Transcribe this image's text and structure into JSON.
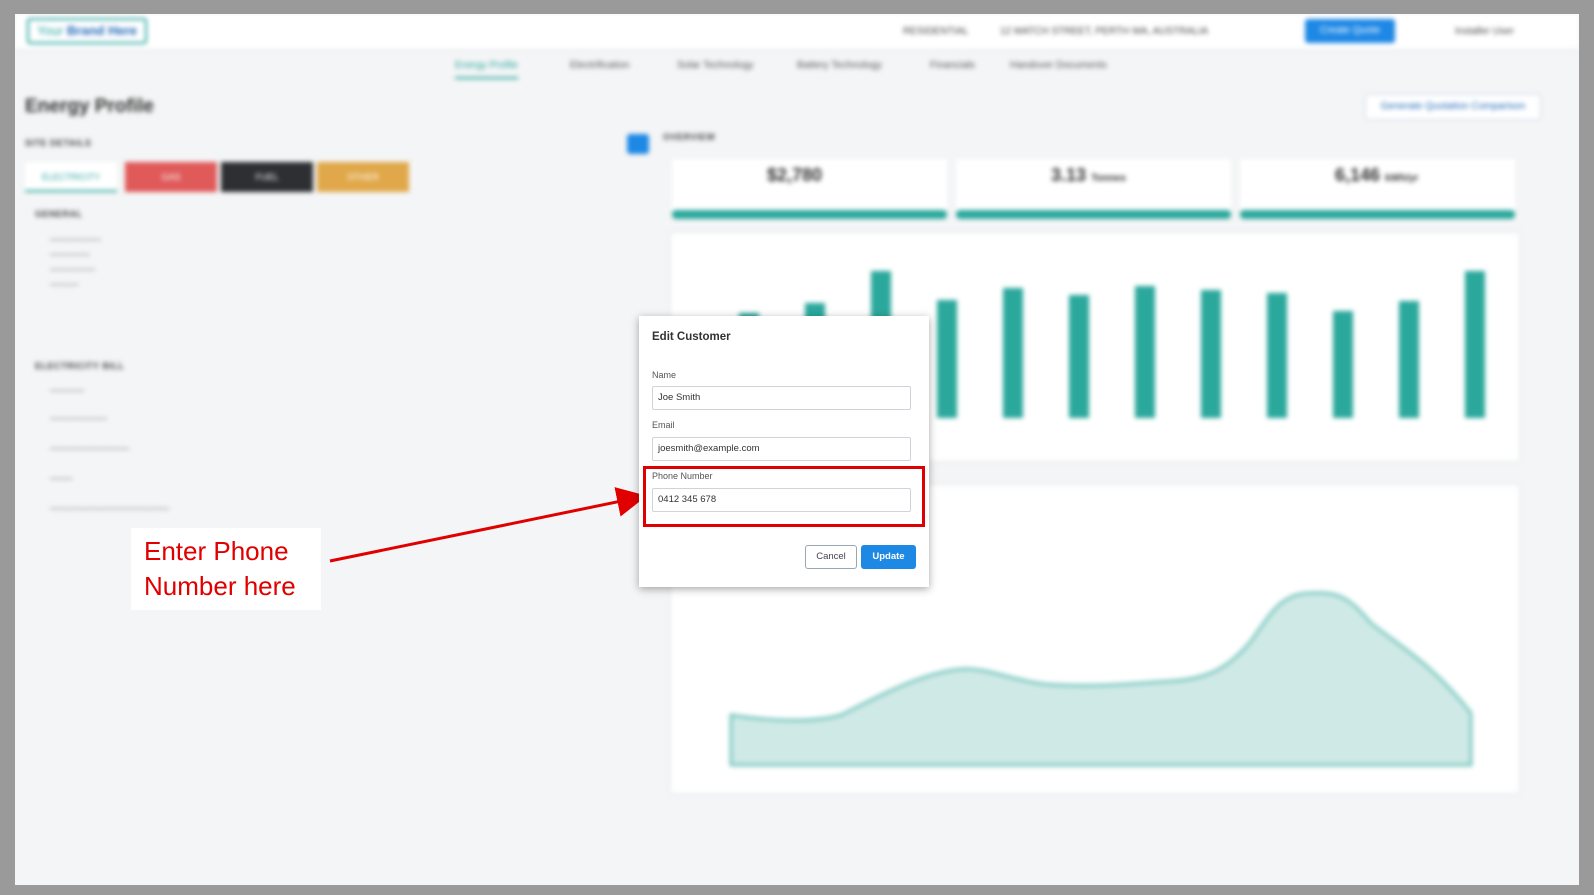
{
  "background_app": {
    "brand": {
      "prefix": "Your",
      "name": "Brand Here"
    },
    "topbar": {
      "type": "RESIDENTIAL",
      "address": "12 MATCH STREET, PERTH WA, AUSTRALIA",
      "create_label": "Create Quote",
      "user_label": "Installer User"
    },
    "tabs": [
      "Energy Profile",
      "Electrification",
      "Solar Technology",
      "Battery Technology",
      "Financials",
      "Handover Documents"
    ],
    "page_title": "Energy Profile",
    "site_details_title": "SITE DETAILS",
    "overview_title": "OVERVIEW",
    "fuel_tabs": [
      "ELECTRICITY",
      "GAS",
      "FUEL",
      "OTHER"
    ],
    "general_title": "GENERAL",
    "bill_title": "ELECTRICITY BILL",
    "kpis": [
      {
        "value": "$2,780",
        "unit": ""
      },
      {
        "value": "3.13",
        "unit": "Tonnes"
      },
      {
        "value": "6,146",
        "unit": "kWh/yr"
      }
    ],
    "right_button_label": "Generate Quotation Comparison",
    "colors": {
      "teal": "#2ba89c",
      "blue": "#1e88e5"
    }
  },
  "modal": {
    "title": "Edit Customer",
    "fields": {
      "name": {
        "label": "Name",
        "value": "Joe Smith"
      },
      "email": {
        "label": "Email",
        "value": "joesmith@example.com"
      },
      "phone": {
        "label": "Phone Number",
        "value": "0412 345 678"
      }
    },
    "cancel_label": "Cancel",
    "update_label": "Update"
  },
  "annotation": {
    "line1": "Enter Phone",
    "line2": "Number here",
    "color": "#e00000"
  }
}
